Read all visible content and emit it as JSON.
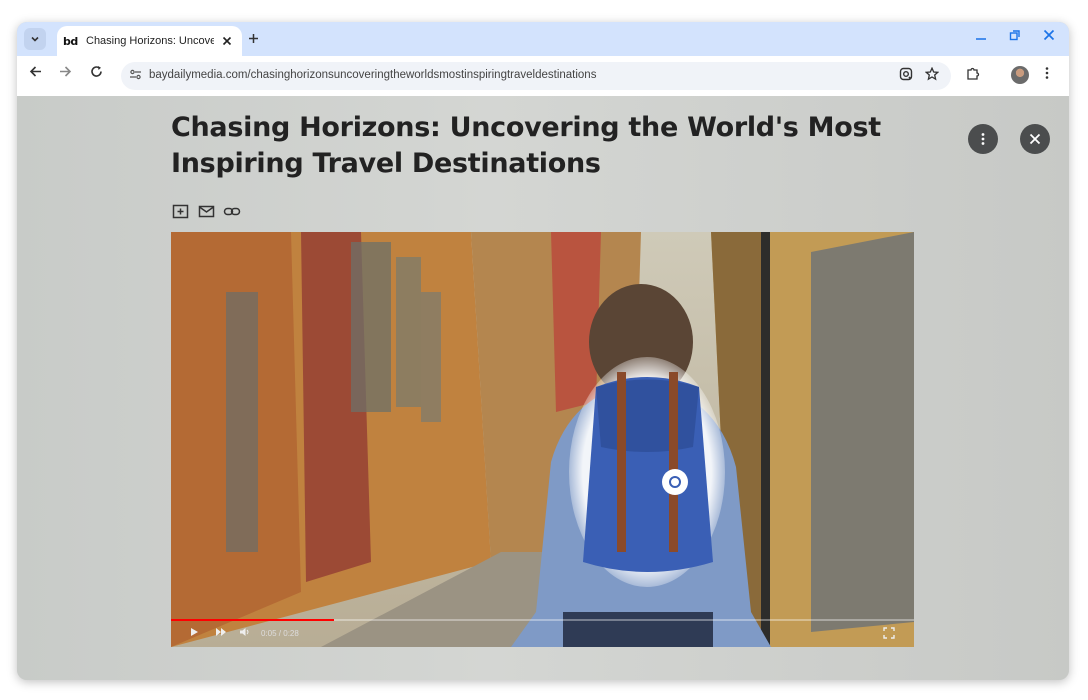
{
  "browser": {
    "tab": {
      "title": "Chasing Horizons: Uncoverin",
      "favicon_text": "bd"
    },
    "url": "baydailymedia.com/chasinghorizonsuncoveringtheworldsmostinspiringtraveldestinations"
  },
  "article": {
    "title": "Chasing Horizons: Uncovering the World's Most Inspiring Travel Destinations"
  },
  "video": {
    "time": "0:05 / 0:28",
    "progress": 0.22
  },
  "icons": {
    "tab_search": "chevron-down-icon",
    "close_tab": "close-icon",
    "new_tab": "plus-icon",
    "back": "arrow-left-icon",
    "forward": "arrow-right-icon",
    "reload": "reload-icon",
    "lens": "google-lens-icon",
    "bookmark": "star-icon",
    "extensions": "puzzle-icon",
    "menu": "more-vert-icon"
  },
  "colors": {
    "accent": "#1a73e8",
    "tabbar": "#d3e3fd",
    "progress": "#ff0000"
  }
}
